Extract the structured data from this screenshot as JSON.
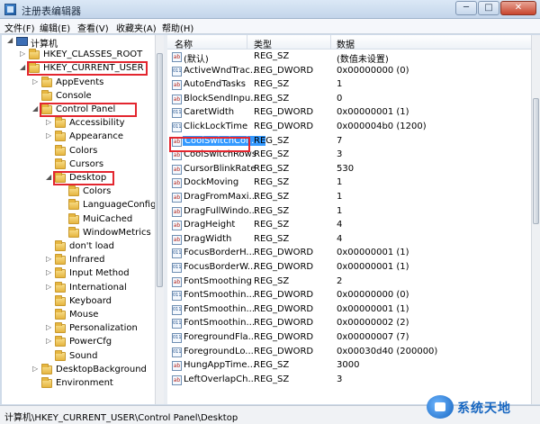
{
  "window": {
    "title": "注册表编辑器"
  },
  "menu": [
    "文件(F)",
    "编辑(E)",
    "查看(V)",
    "收藏夹(A)",
    "帮助(H)"
  ],
  "tree": [
    {
      "label": "计算机",
      "level": 0,
      "twisty": "expanded",
      "kind": "computer"
    },
    {
      "label": "HKEY_CLASSES_ROOT",
      "level": 1,
      "twisty": "collapsed"
    },
    {
      "label": "HKEY_CURRENT_USER",
      "level": 1,
      "twisty": "expanded",
      "highlighted": true
    },
    {
      "label": "AppEvents",
      "level": 2,
      "twisty": "collapsed"
    },
    {
      "label": "Console",
      "level": 2,
      "twisty": "none"
    },
    {
      "label": "Control Panel",
      "level": 2,
      "twisty": "expanded",
      "highlighted": true
    },
    {
      "label": "Accessibility",
      "level": 3,
      "twisty": "collapsed"
    },
    {
      "label": "Appearance",
      "level": 3,
      "twisty": "collapsed"
    },
    {
      "label": "Colors",
      "level": 3,
      "twisty": "none"
    },
    {
      "label": "Cursors",
      "level": 3,
      "twisty": "none"
    },
    {
      "label": "Desktop",
      "level": 3,
      "twisty": "expanded",
      "highlighted": true
    },
    {
      "label": "Colors",
      "level": 4,
      "twisty": "none"
    },
    {
      "label": "LanguageConfig",
      "level": 4,
      "twisty": "none"
    },
    {
      "label": "MuiCached",
      "level": 4,
      "twisty": "none"
    },
    {
      "label": "WindowMetrics",
      "level": 4,
      "twisty": "none"
    },
    {
      "label": "don't load",
      "level": 3,
      "twisty": "none"
    },
    {
      "label": "Infrared",
      "level": 3,
      "twisty": "collapsed"
    },
    {
      "label": "Input Method",
      "level": 3,
      "twisty": "collapsed"
    },
    {
      "label": "International",
      "level": 3,
      "twisty": "collapsed"
    },
    {
      "label": "Keyboard",
      "level": 3,
      "twisty": "none"
    },
    {
      "label": "Mouse",
      "level": 3,
      "twisty": "none"
    },
    {
      "label": "Personalization",
      "level": 3,
      "twisty": "collapsed"
    },
    {
      "label": "PowerCfg",
      "level": 3,
      "twisty": "collapsed"
    },
    {
      "label": "Sound",
      "level": 3,
      "twisty": "none"
    },
    {
      "label": "DesktopBackground",
      "level": 2,
      "twisty": "collapsed"
    },
    {
      "label": "Environment",
      "level": 2,
      "twisty": "none"
    }
  ],
  "columns": {
    "name": "名称",
    "type": "类型",
    "data": "数据"
  },
  "values": [
    {
      "name": "(默认)",
      "type": "REG_SZ",
      "data": "(数值未设置)",
      "icon": "string-value-icon"
    },
    {
      "name": "ActiveWndTrac...",
      "type": "REG_DWORD",
      "data": "0x00000000 (0)",
      "icon": "binary-value-icon"
    },
    {
      "name": "AutoEndTasks",
      "type": "REG_SZ",
      "data": "1",
      "icon": "string-value-icon"
    },
    {
      "name": "BlockSendInpu...",
      "type": "REG_SZ",
      "data": "0",
      "icon": "string-value-icon"
    },
    {
      "name": "CaretWidth",
      "type": "REG_DWORD",
      "data": "0x00000001 (1)",
      "icon": "binary-value-icon"
    },
    {
      "name": "ClickLockTime",
      "type": "REG_DWORD",
      "data": "0x000004b0 (1200)",
      "icon": "binary-value-icon"
    },
    {
      "name": "CoolSwitchCol...",
      "type": "REG_SZ",
      "data": "7",
      "icon": "string-value-icon",
      "selected": true
    },
    {
      "name": "CoolSwitchRows",
      "type": "REG_SZ",
      "data": "3",
      "icon": "string-value-icon"
    },
    {
      "name": "CursorBlinkRate",
      "type": "REG_SZ",
      "data": "530",
      "icon": "string-value-icon"
    },
    {
      "name": "DockMoving",
      "type": "REG_SZ",
      "data": "1",
      "icon": "string-value-icon"
    },
    {
      "name": "DragFromMaxi...",
      "type": "REG_SZ",
      "data": "1",
      "icon": "string-value-icon"
    },
    {
      "name": "DragFullWindo...",
      "type": "REG_SZ",
      "data": "1",
      "icon": "string-value-icon"
    },
    {
      "name": "DragHeight",
      "type": "REG_SZ",
      "data": "4",
      "icon": "string-value-icon"
    },
    {
      "name": "DragWidth",
      "type": "REG_SZ",
      "data": "4",
      "icon": "string-value-icon"
    },
    {
      "name": "FocusBorderH...",
      "type": "REG_DWORD",
      "data": "0x00000001 (1)",
      "icon": "binary-value-icon"
    },
    {
      "name": "FocusBorderW...",
      "type": "REG_DWORD",
      "data": "0x00000001 (1)",
      "icon": "binary-value-icon"
    },
    {
      "name": "FontSmoothing",
      "type": "REG_SZ",
      "data": "2",
      "icon": "string-value-icon"
    },
    {
      "name": "FontSmoothin...",
      "type": "REG_DWORD",
      "data": "0x00000000 (0)",
      "icon": "binary-value-icon"
    },
    {
      "name": "FontSmoothin...",
      "type": "REG_DWORD",
      "data": "0x00000001 (1)",
      "icon": "binary-value-icon"
    },
    {
      "name": "FontSmoothin...",
      "type": "REG_DWORD",
      "data": "0x00000002 (2)",
      "icon": "binary-value-icon"
    },
    {
      "name": "ForegroundFla...",
      "type": "REG_DWORD",
      "data": "0x00000007 (7)",
      "icon": "binary-value-icon"
    },
    {
      "name": "ForegroundLo...",
      "type": "REG_DWORD",
      "data": "0x00030d40 (200000)",
      "icon": "binary-value-icon"
    },
    {
      "name": "HungAppTime...",
      "type": "REG_SZ",
      "data": "3000",
      "icon": "string-value-icon"
    },
    {
      "name": "LeftOverlapCh...",
      "type": "REG_SZ",
      "data": "3",
      "icon": "string-value-icon"
    }
  ],
  "status": "计算机\\HKEY_CURRENT_USER\\Control Panel\\Desktop",
  "watermark": "系统天地"
}
